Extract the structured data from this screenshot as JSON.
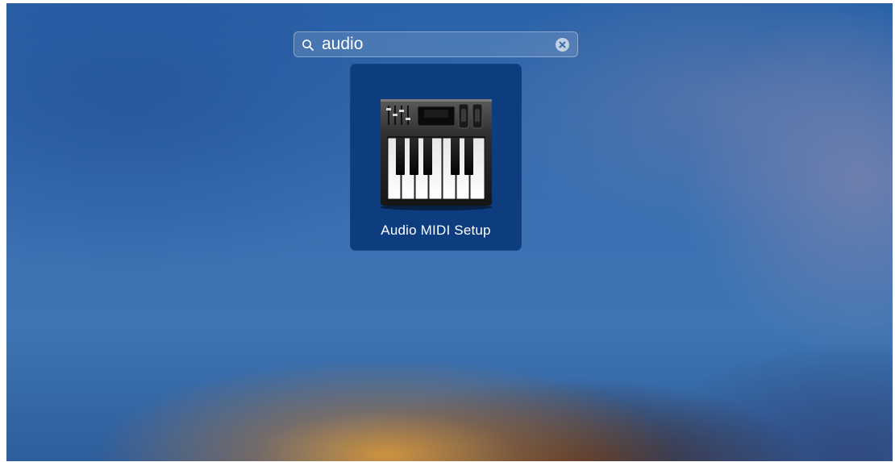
{
  "search": {
    "query": "audio",
    "icon": "search-icon",
    "clear_icon": "clear-icon"
  },
  "results": [
    {
      "label": "Audio MIDI Setup",
      "icon": "audio-midi-setup-icon"
    }
  ],
  "colors": {
    "result_highlight": "#0d3d7e",
    "text": "#ffffff"
  }
}
